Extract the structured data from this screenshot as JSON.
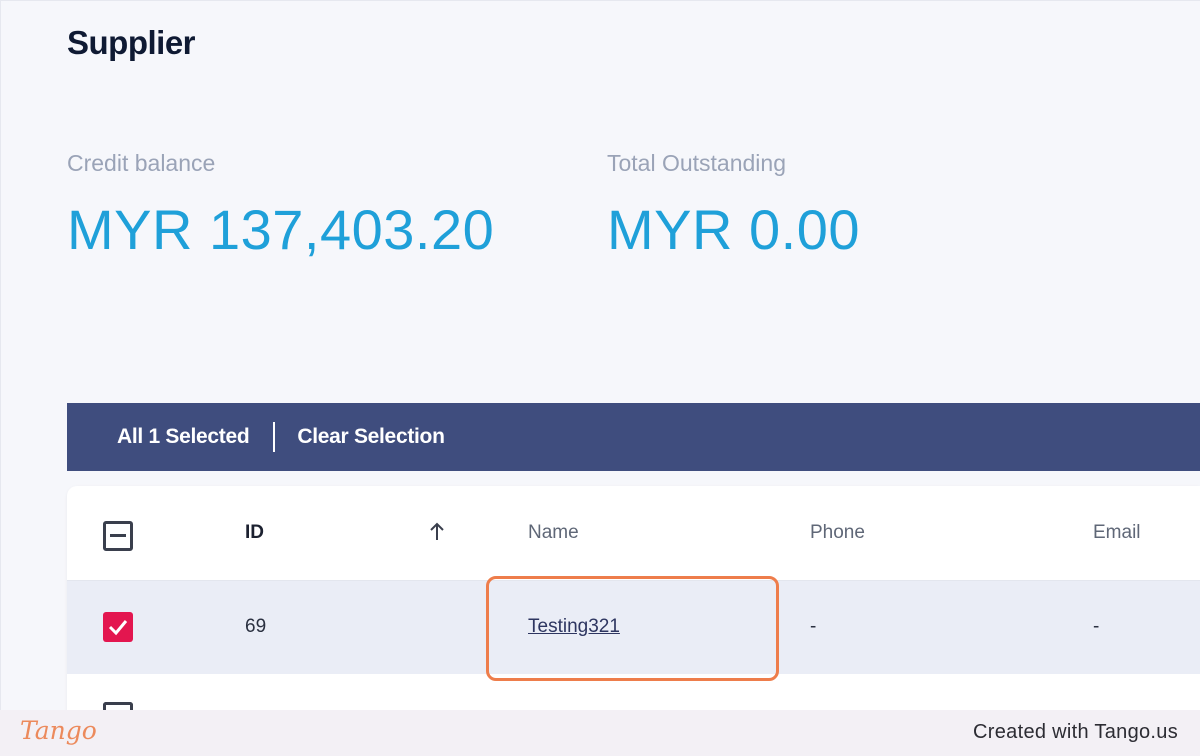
{
  "page": {
    "title": "Supplier"
  },
  "stats": {
    "credit_balance": {
      "label": "Credit balance",
      "value": "MYR 137,403.20"
    },
    "total_outstanding": {
      "label": "Total Outstanding",
      "value": "MYR 0.00"
    }
  },
  "selection_bar": {
    "count_label": "All 1 Selected",
    "clear_label": "Clear Selection"
  },
  "table": {
    "columns": [
      "ID",
      "Name",
      "Phone",
      "Email"
    ],
    "sort_icon": "arrow-up-icon",
    "rows": [
      {
        "selected": true,
        "id": "69",
        "name": "Testing321",
        "phone": "-",
        "email": "-"
      }
    ]
  },
  "footer": {
    "logo_text": "Tango",
    "created_with": "Created with Tango.us"
  },
  "colors": {
    "accent": "#1fa0d9",
    "selection_bar": "#3f4d7e",
    "checkbox_checked": "#e3164f",
    "highlight": "#ee7d4b"
  }
}
